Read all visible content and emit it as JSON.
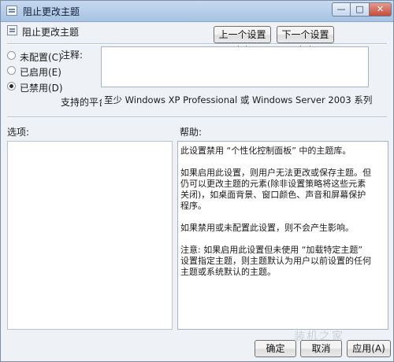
{
  "window": {
    "title": "阻止更改主题",
    "controls": {
      "minimize": "—",
      "maximize": "□",
      "close": "✕"
    }
  },
  "header": {
    "policy_name": "阻止更改主题",
    "prev_button": "上一个设置(P)",
    "next_button": "下一个设置(N)"
  },
  "options": [
    {
      "label": "未配置(C)",
      "selected": false
    },
    {
      "label": "已启用(E)",
      "selected": false
    },
    {
      "label": "已禁用(D)",
      "selected": true
    }
  ],
  "comment": {
    "label": "注释:",
    "value": ""
  },
  "platform": {
    "label": "支持的平台:",
    "value": "至少 Windows XP Professional 或 Windows Server 2003 系列"
  },
  "options_pane": {
    "label": "选项:"
  },
  "help_pane": {
    "label": "帮助:",
    "paragraphs": [
      "此设置禁用 “个性化控制面板” 中的主题库。",
      "如果启用此设置，则用户无法更改或保存主题。但仍可以更改主题的元素(除非设置策略将这些元素关闭)，如桌面背景、窗口颜色、声音和屏幕保护程序。",
      "如果禁用或未配置此设置，则不会产生影响。",
      "注意: 如果启用此设置但未使用 “加载特定主题” 设置指定主题，则主题默认为用户以前设置的任何主题或系统默认的主题。"
    ]
  },
  "footer": {
    "ok_button": "确定",
    "cancel_button": "取消",
    "apply_button": "应用(A)"
  },
  "watermark": "装机之家",
  "icons": {
    "title": "policy-icon",
    "header": "policy-icon"
  },
  "colors": {
    "titlebar": "#b9cfea",
    "close_button": "#c44b3c",
    "window_bg": "#eef1f5"
  }
}
